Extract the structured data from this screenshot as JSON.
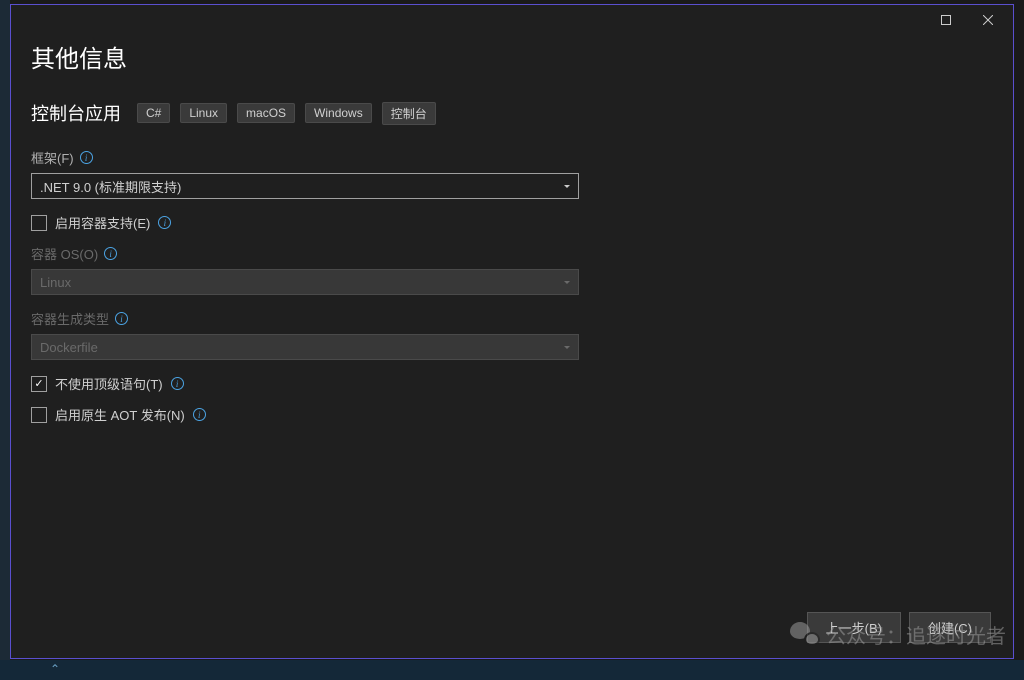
{
  "page_title": "其他信息",
  "subtitle": "控制台应用",
  "tags": [
    "C#",
    "Linux",
    "macOS",
    "Windows",
    "控制台"
  ],
  "framework": {
    "label": "框架(F)",
    "value": ".NET 9.0 (标准期限支持)"
  },
  "container_support": {
    "label": "启用容器支持(E)",
    "checked": false
  },
  "container_os": {
    "label": "容器 OS(O)",
    "value": "Linux"
  },
  "container_build_type": {
    "label": "容器生成类型",
    "value": "Dockerfile"
  },
  "no_toplevel": {
    "label": "不使用顶级语句(T)",
    "checked": true
  },
  "aot_publish": {
    "label": "启用原生 AOT 发布(N)",
    "checked": false
  },
  "buttons": {
    "back": "上一步(B)",
    "create": "创建(C)"
  },
  "watermark": "公众号：追逐时光者"
}
